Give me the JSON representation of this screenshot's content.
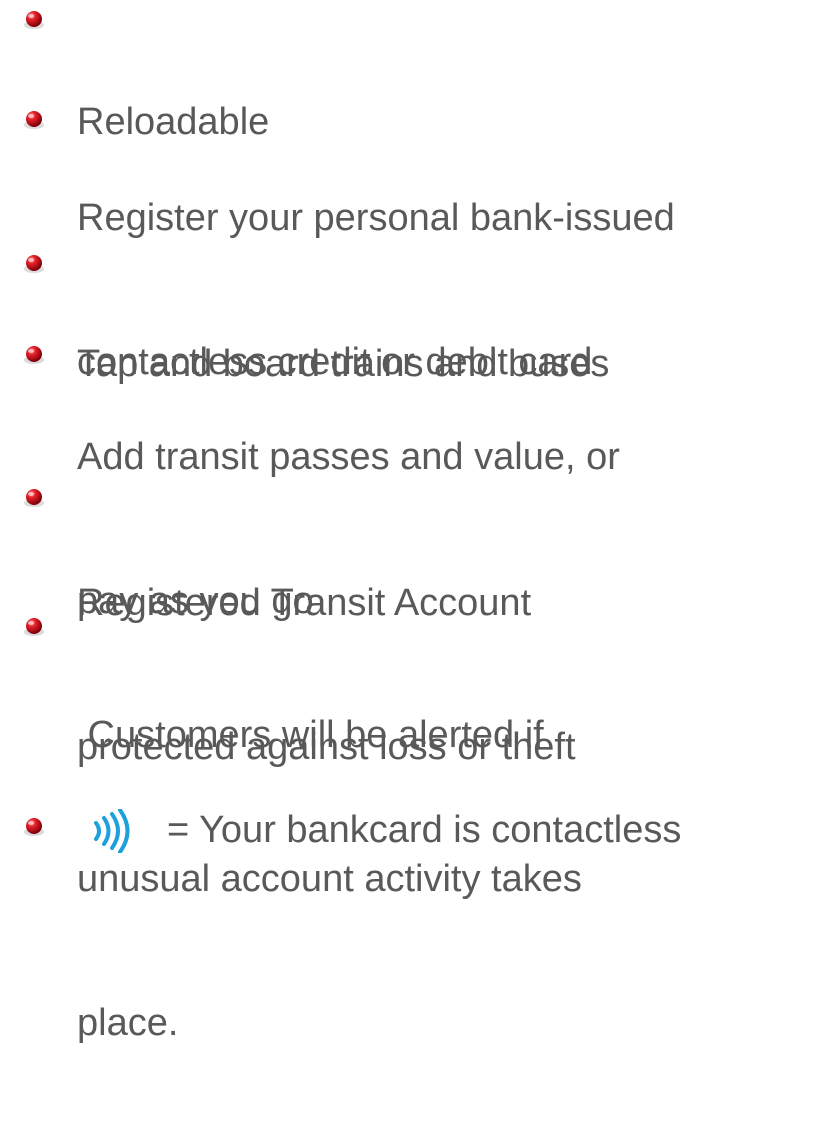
{
  "bullets": [
    {
      "lines": [
        "Reloadable"
      ]
    },
    {
      "lines": [
        "Register your personal bank-issued",
        "contactless credit or debit card"
      ]
    },
    {
      "lines": [
        "Tap and board trains and buses"
      ]
    },
    {
      "lines": [
        "Add transit passes and value, or",
        "pay as you go"
      ]
    },
    {
      "lines": [
        "Registered Transit Account",
        "protected against loss or theft"
      ]
    },
    {
      "lines": [
        " Customers will be alerted if",
        "unusual account activity takes",
        "place."
      ]
    }
  ],
  "last_item": {
    "icon": "contactless-icon",
    "text": "= Your bankcard is contactless"
  },
  "colors": {
    "text": "#595959",
    "bullet": "#d0111b",
    "icon": "#1ea0dc"
  }
}
